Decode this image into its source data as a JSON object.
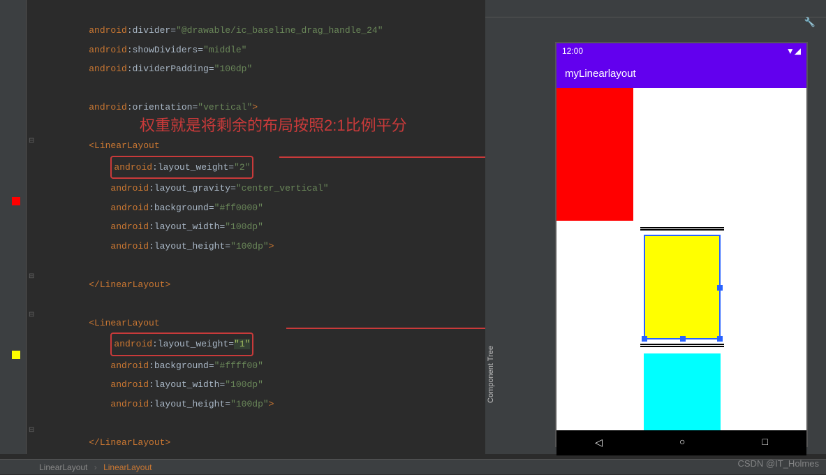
{
  "code": {
    "lines": [
      {
        "indent": 1,
        "type": "attr",
        "ns": "android",
        "name": "divider",
        "val": "\"@drawable/ic_baseline_drag_handle_24\""
      },
      {
        "indent": 1,
        "type": "attr",
        "ns": "android",
        "name": "showDividers",
        "val": "\"middle\""
      },
      {
        "indent": 1,
        "type": "attr",
        "ns": "android",
        "name": "dividerPadding",
        "val": "\"100dp\""
      },
      {
        "indent": 1,
        "type": "blank"
      },
      {
        "indent": 1,
        "type": "attr",
        "ns": "android",
        "name": "orientation",
        "val": "\"vertical\"",
        "close": ">"
      },
      {
        "indent": 1,
        "type": "blank"
      },
      {
        "indent": 1,
        "type": "open-tag",
        "tag": "LinearLayout"
      },
      {
        "indent": 2,
        "type": "attr-boxed",
        "ns": "android",
        "name": "layout_weight",
        "val": "\"2\""
      },
      {
        "indent": 2,
        "type": "attr",
        "ns": "android",
        "name": "layout_gravity",
        "val": "\"center_vertical\""
      },
      {
        "indent": 2,
        "type": "attr",
        "ns": "android",
        "name": "background",
        "val": "\"#ff0000\""
      },
      {
        "indent": 2,
        "type": "attr",
        "ns": "android",
        "name": "layout_width",
        "val": "\"100dp\""
      },
      {
        "indent": 2,
        "type": "attr",
        "ns": "android",
        "name": "layout_height",
        "val": "\"100dp\"",
        "close": ">"
      },
      {
        "indent": 1,
        "type": "blank"
      },
      {
        "indent": 1,
        "type": "close-tag",
        "tag": "LinearLayout"
      },
      {
        "indent": 1,
        "type": "blank"
      },
      {
        "indent": 1,
        "type": "open-tag",
        "tag": "LinearLayout"
      },
      {
        "indent": 2,
        "type": "attr-boxed-green",
        "ns": "android",
        "name": "layout_weight",
        "val": "\"1\""
      },
      {
        "indent": 2,
        "type": "attr",
        "ns": "android",
        "name": "background",
        "val": "\"#ffff00\""
      },
      {
        "indent": 2,
        "type": "attr",
        "ns": "android",
        "name": "layout_width",
        "val": "\"100dp\""
      },
      {
        "indent": 2,
        "type": "attr",
        "ns": "android",
        "name": "layout_height",
        "val": "\"100dp\"",
        "close": ">"
      },
      {
        "indent": 1,
        "type": "blank"
      },
      {
        "indent": 1,
        "type": "close-tag",
        "tag": "LinearLayout"
      }
    ]
  },
  "annotation": "权重就是将剩余的布局按照2:1比例平分",
  "preview": {
    "status_time": "12:00",
    "app_title": "myLinearlayout",
    "vertical_tab": "Component Tree"
  },
  "breadcrumb": {
    "item1": "LinearLayout",
    "item2": "LinearLayout"
  },
  "watermark": "CSDN @IT_Holmes"
}
